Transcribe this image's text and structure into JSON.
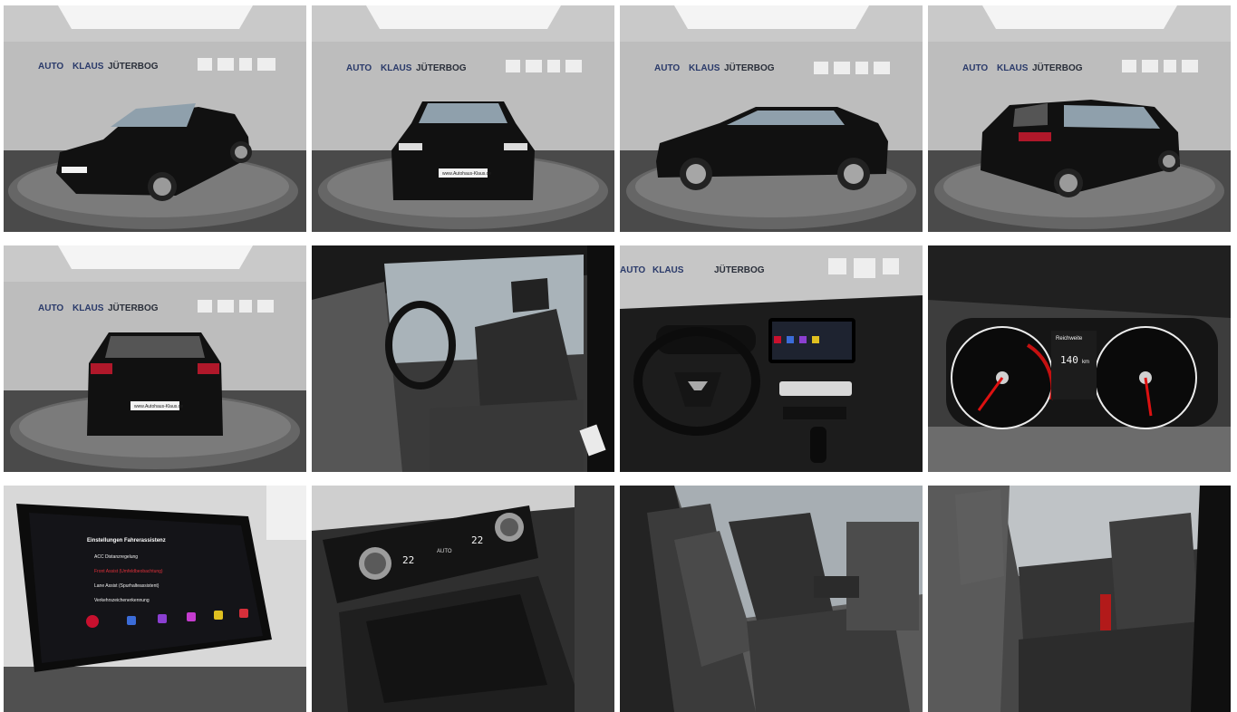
{
  "dealer": {
    "name_left": "AUTO",
    "name_right": "KLAUS",
    "city": "JÜTERBOG"
  },
  "plate_text": "www.Autohaus-Klaus.de",
  "infotainment": {
    "title": "Einstellungen Fahrerassistenz",
    "items": [
      "ACC Distanzregelung",
      "Front Assist (Umfeldbeobachtung)",
      "Lane Assist (Spurhalteassistent)",
      "Verkehrszeichenerkennung"
    ]
  },
  "instrument_cluster": {
    "range_label": "Reichweite",
    "range_value": "140",
    "range_unit": "km"
  },
  "climate": {
    "left_temp": "22",
    "right_temp": "22",
    "auto_label": "AUTO"
  },
  "photos": [
    {
      "name": "exterior-front-left"
    },
    {
      "name": "exterior-front"
    },
    {
      "name": "exterior-side"
    },
    {
      "name": "exterior-rear-left"
    },
    {
      "name": "exterior-rear"
    },
    {
      "name": "interior-front-seats"
    },
    {
      "name": "interior-dashboard"
    },
    {
      "name": "instrument-cluster"
    },
    {
      "name": "infotainment-screen"
    },
    {
      "name": "climate-control"
    },
    {
      "name": "interior-side-seats"
    },
    {
      "name": "rear-seats"
    }
  ]
}
